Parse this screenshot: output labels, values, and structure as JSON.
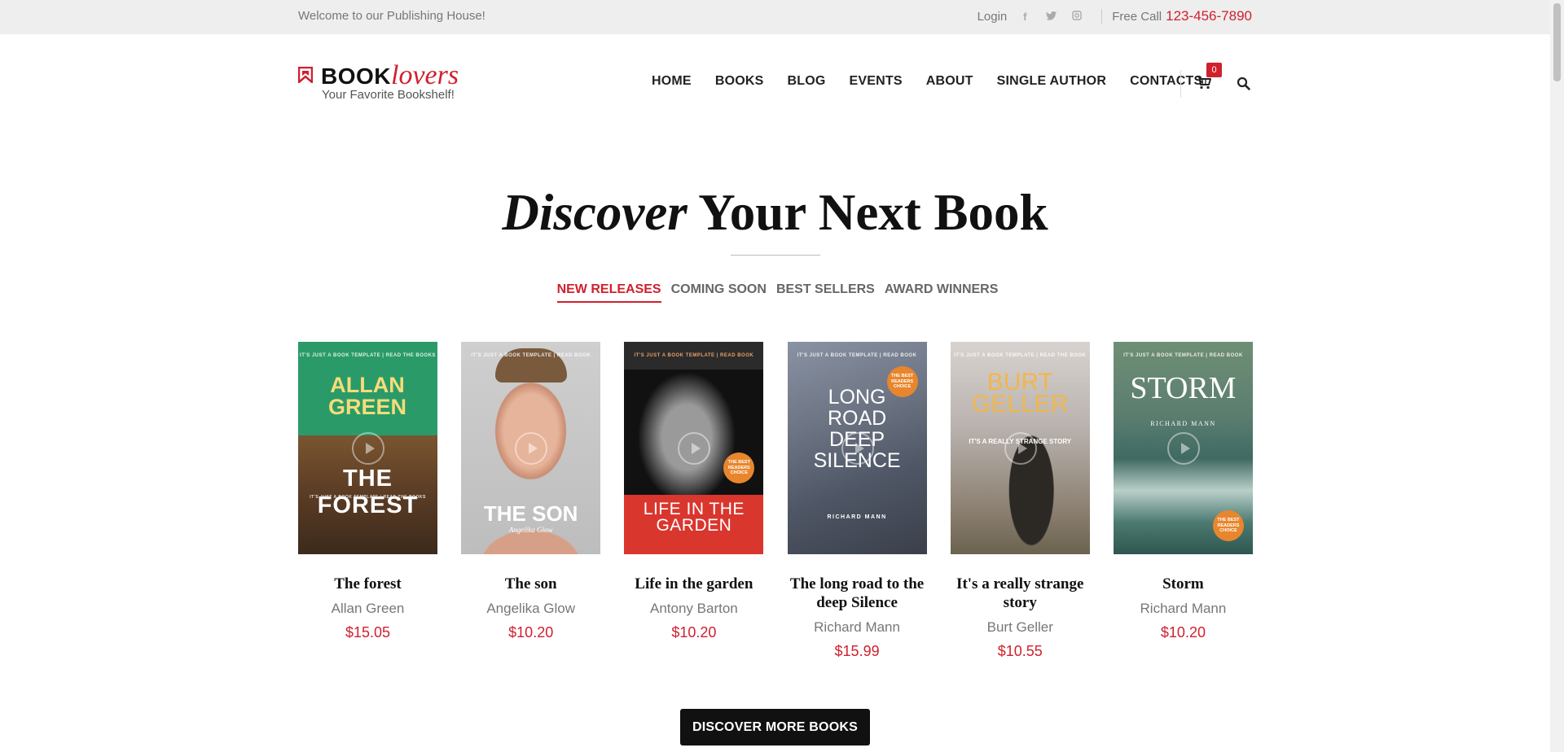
{
  "topbar": {
    "welcome": "Welcome to our Publishing House!",
    "login": "Login",
    "social_icons": [
      "facebook-icon",
      "twitter-icon",
      "instagram-icon"
    ],
    "free_call_label": "Free Call",
    "phone": "123-456-7890"
  },
  "header": {
    "logo_bold": "BOOK",
    "logo_italic": "lovers",
    "tagline": "Your Favorite Bookshelf!",
    "nav": [
      "HOME",
      "BOOKS",
      "BLOG",
      "EVENTS",
      "ABOUT",
      "SINGLE AUTHOR",
      "CONTACTS"
    ],
    "cart_count": "0",
    "icons": [
      "cart-icon",
      "search-icon"
    ]
  },
  "hero": {
    "title_italic": "Discover",
    "title_rest": " Your Next Book"
  },
  "tabs": [
    {
      "label": "NEW RELEASES",
      "active": true
    },
    {
      "label": "COMING SOON",
      "active": false
    },
    {
      "label": "BEST SELLERS",
      "active": false
    },
    {
      "label": "AWARD WINNERS",
      "active": false
    }
  ],
  "books": [
    {
      "title": "The forest",
      "author": "Allan Green",
      "price": "$15.05",
      "cover": {
        "top_line": "IT'S JUST A BOOK TEMPLATE | READ THE BOOKS",
        "author_text": "ALLAN GREEN",
        "title_text": "THE FOREST",
        "sub_text": "IT'S JUST A BOOK TEMPLATE | READ THE BOOKS"
      }
    },
    {
      "title": "The son",
      "author": "Angelika Glow",
      "price": "$10.20",
      "cover": {
        "top_line": "IT'S JUST A BOOK TEMPLATE | READ BOOK",
        "title_text": "THE SON",
        "author_text": "Angelika Glow"
      }
    },
    {
      "title": "Life in the garden",
      "author": "Antony Barton",
      "price": "$10.20",
      "cover": {
        "top_line": "IT'S JUST A BOOK TEMPLATE | READ BOOK",
        "title_text": "LIFE IN THE GARDEN",
        "seal": "THE BEST READERS CHOICE"
      }
    },
    {
      "title": "The long road to the deep Silence",
      "author": "Richard Mann",
      "price": "$15.99",
      "cover": {
        "top_line": "IT'S JUST A BOOK TEMPLATE | READ BOOK",
        "title_text": "LONG ROAD DEEP SILENCE",
        "author_text": "RICHARD MANN",
        "seal": "THE BEST READERS CHOICE"
      }
    },
    {
      "title": "It's a really strange story",
      "author": "Burt Geller",
      "price": "$10.55",
      "cover": {
        "top_line": "IT'S JUST A BOOK TEMPLATE | READ THE BOOK",
        "author_text": "BURT GELLER",
        "title_text": "IT'S A REALLY STRANGE STORY"
      }
    },
    {
      "title": "Storm",
      "author": "Richard Mann",
      "price": "$10.20",
      "cover": {
        "top_line": "IT'S JUST A BOOK TEMPLATE | READ BOOK",
        "title_text": "STORM",
        "author_text": "RICHARD MANN",
        "seal": "THE BEST READERS CHOICE"
      }
    }
  ],
  "cta": {
    "label": "DISCOVER MORE BOOKS"
  },
  "colors": {
    "accent": "#d0202e",
    "topbar_bg": "#eeeeee",
    "button_bg": "#111111"
  }
}
